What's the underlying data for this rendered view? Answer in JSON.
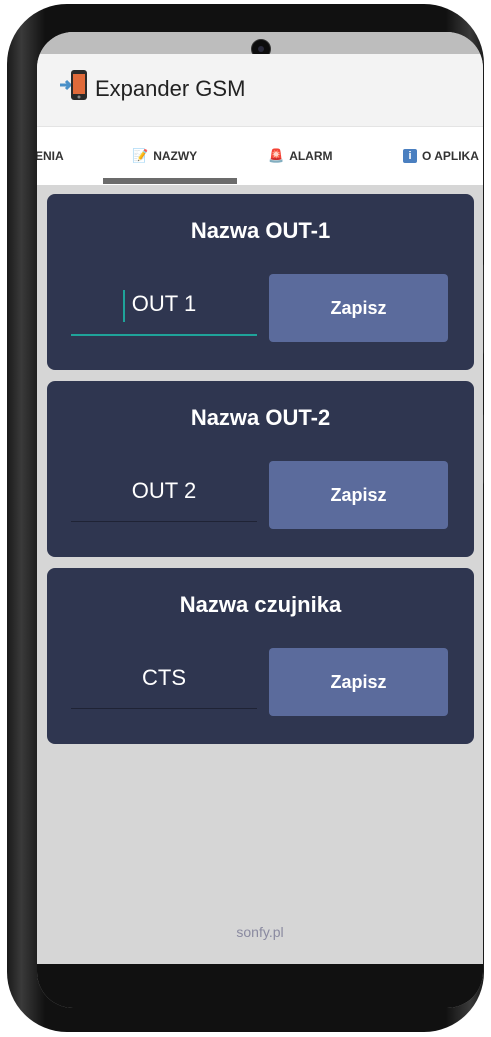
{
  "app": {
    "title": "Expander GSM",
    "icon": "phone-transfer-icon"
  },
  "tabs": [
    {
      "label": "ENIA",
      "icon": ""
    },
    {
      "label": "NAZWY",
      "icon": "memo-icon",
      "selected": true
    },
    {
      "label": "ALARM",
      "icon": "siren-icon"
    },
    {
      "label": "O APLIKA",
      "icon": "info-icon"
    }
  ],
  "cards": [
    {
      "title": "Nazwa OUT-1",
      "value": "OUT 1",
      "button": "Zapisz",
      "focused": true
    },
    {
      "title": "Nazwa OUT-2",
      "value": "OUT 2",
      "button": "Zapisz"
    },
    {
      "title": "Nazwa czujnika",
      "value": "CTS",
      "button": "Zapisz"
    }
  ],
  "footer": {
    "text": "sonfy.pl"
  },
  "colors": {
    "card_bg": "#2f3650",
    "button_bg": "#5b6b9c",
    "accent": "#1fa39a",
    "screen_bg": "#d6d6d6"
  }
}
